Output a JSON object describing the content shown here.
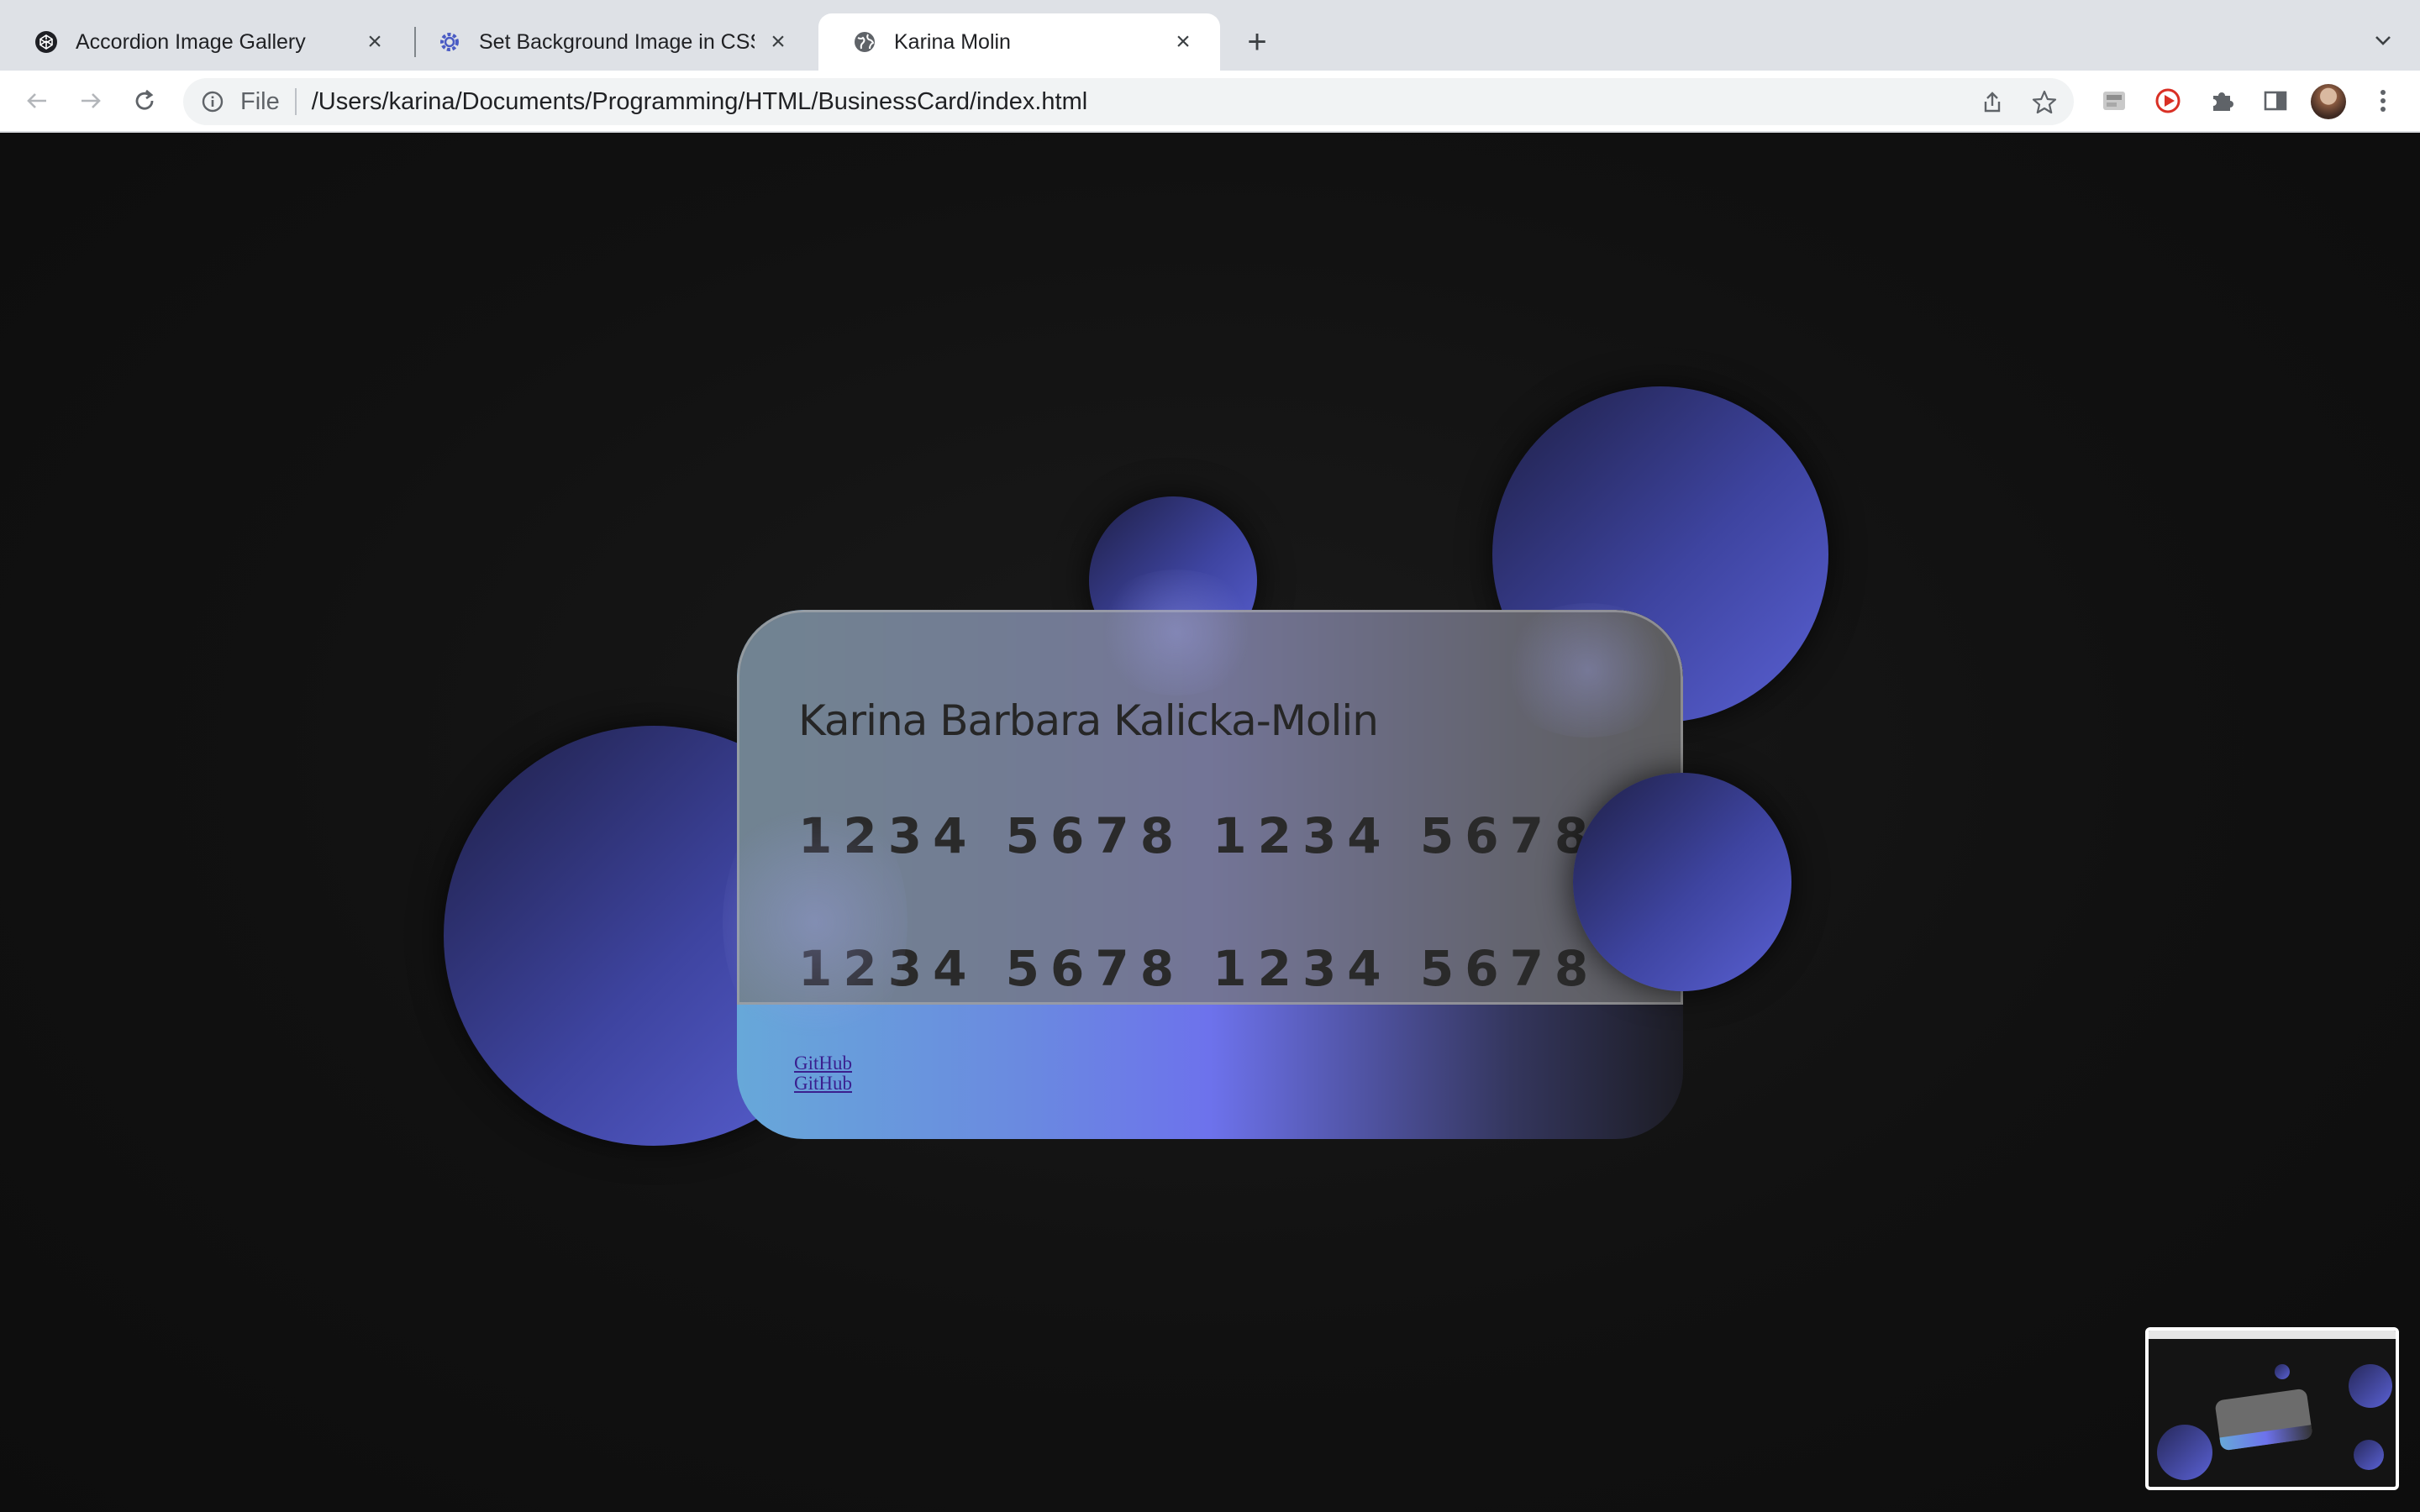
{
  "browser": {
    "tabs": [
      {
        "title": "Accordion Image Gallery",
        "icon": "codepen-icon",
        "active": false
      },
      {
        "title": "Set Background Image in CSS |",
        "icon": "gear-icon",
        "active": false
      },
      {
        "title": "Karina Molin",
        "icon": "globe-icon",
        "active": true
      }
    ],
    "new_tab_label": "+",
    "address_bar": {
      "scheme_label": "File",
      "url": "/Users/karina/Documents/Programming/HTML/BusinessCard/index.html"
    },
    "toolbar_icons": [
      "share-icon",
      "star-icon",
      "extension-app-icon",
      "screen-recorder-icon",
      "puzzle-icon",
      "side-panel-icon",
      "avatar",
      "kebab-menu-icon"
    ],
    "colors": {
      "tabstrip": "#dee1e6",
      "toolbar": "#ffffff",
      "omnibox": "#f1f3f4"
    }
  },
  "page": {
    "card": {
      "name": "Karina Barbara Kalicka-Molin",
      "number_line_1": "1234 5678 1234 5678",
      "number_line_2": "1234 5678 1234 5678",
      "links": [
        "GitHub",
        "GitHub"
      ]
    },
    "colors": {
      "background": "#111111",
      "circle_gradient": [
        "#1e1f45",
        "#5a61d4"
      ],
      "card_glass": "#767676",
      "card_strip_gradient": [
        "#67a8d9",
        "#6d72ec",
        "#1c1c24"
      ],
      "link": "#3a1f8f"
    }
  }
}
